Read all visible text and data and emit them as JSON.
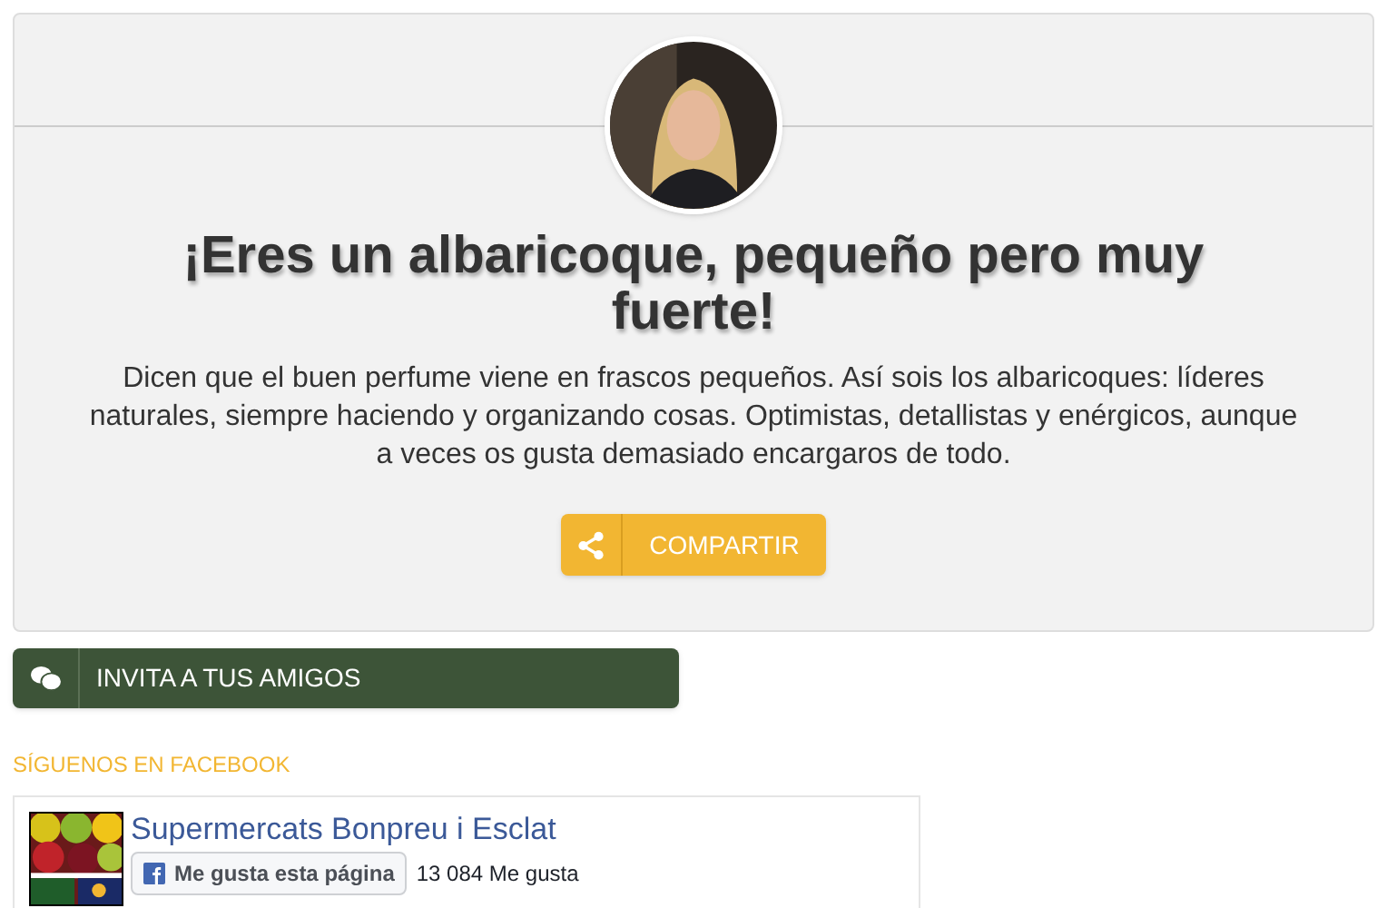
{
  "result": {
    "title": "¡Eres un albaricoque, pequeño pero muy fuerte!",
    "description": "Dicen que el buen perfume viene en frascos pequeños. Así sois los albaricoques: líderes naturales, siempre haciendo y organizando cosas. Optimistas, detallistas y enérgicos, aunque a veces os gusta demasiado encargaros de todo.",
    "share_button": "COMPARTIR"
  },
  "invite_button": "INVITA A TUS AMIGOS",
  "facebook": {
    "heading": "SÍGUENOS EN FACEBOOK",
    "page_name": "Supermercats Bonpreu i Esclat",
    "like_button": "Me gusta esta página",
    "like_count": "13 084 Me gusta"
  }
}
